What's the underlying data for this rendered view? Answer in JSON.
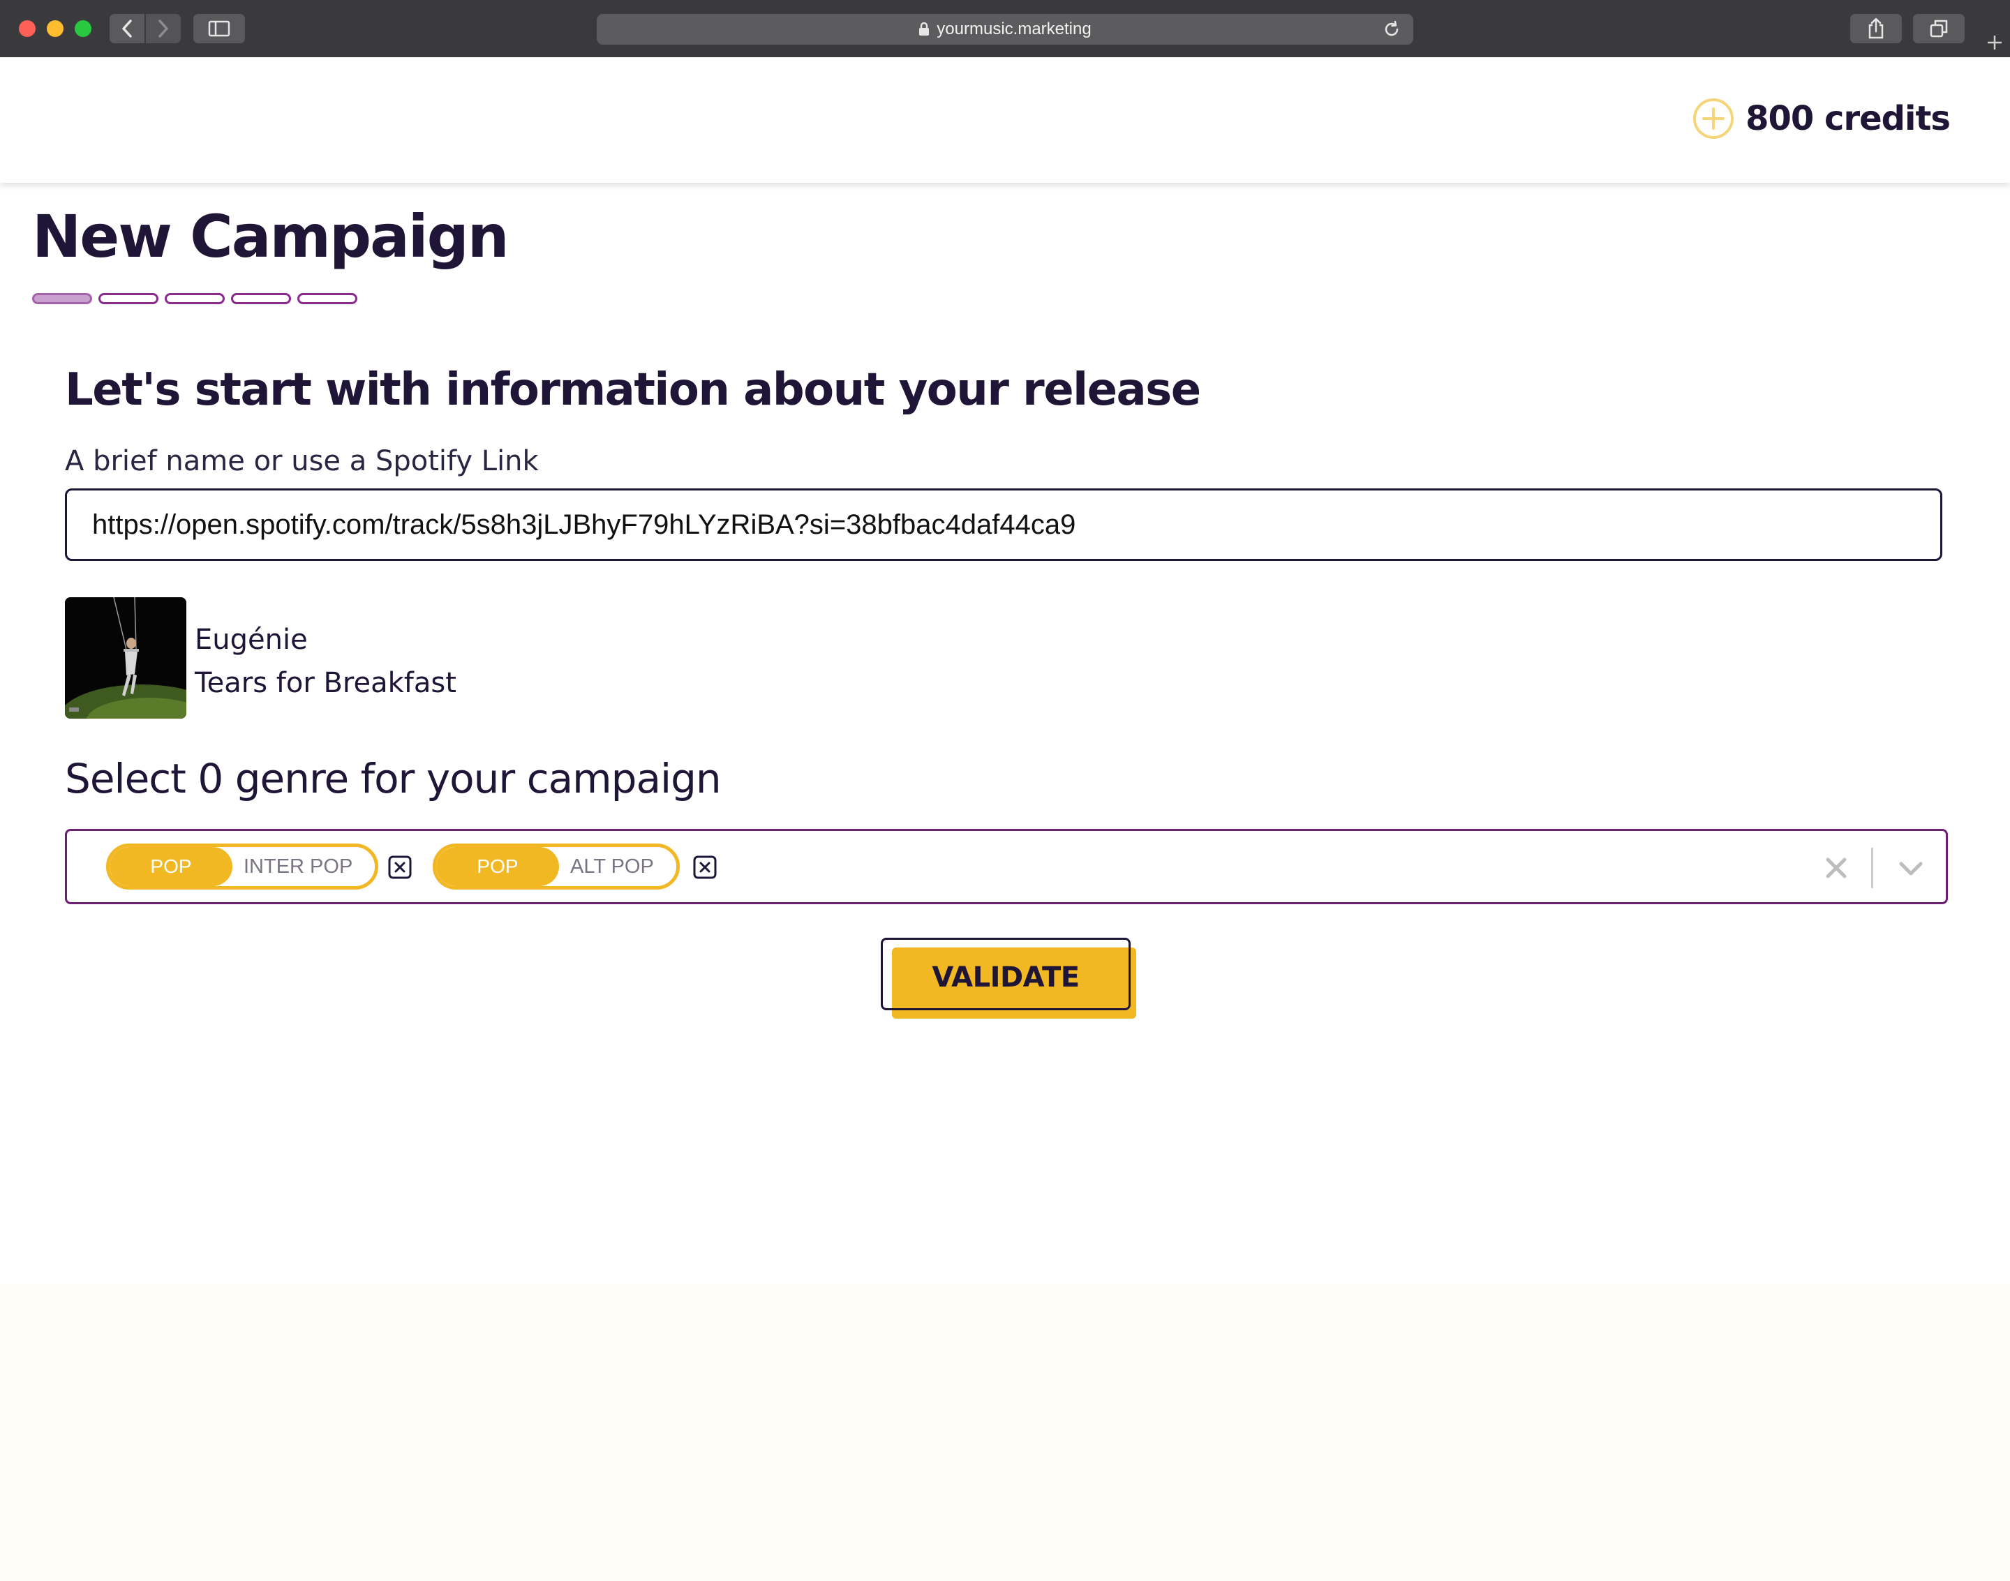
{
  "browser": {
    "url": "yourmusic.marketing"
  },
  "header": {
    "credits": "800 credits"
  },
  "page": {
    "title": "New Campaign",
    "steps_total": 5,
    "current_step": 1
  },
  "release": {
    "heading": "Let's start with information about your release",
    "field_label": "A brief name or use a Spotify Link",
    "field_value": "https://open.spotify.com/track/5s8h3jLJBhyF79hLYzRiBA?si=38bfbac4daf44ca9",
    "track": {
      "artist": "Eugénie",
      "title": "Tears for Breakfast"
    }
  },
  "genres": {
    "label": "Select 0 genre for your campaign",
    "selected": [
      {
        "parent": "POP",
        "sub": "INTER POP"
      },
      {
        "parent": "POP",
        "sub": "ALT POP"
      }
    ]
  },
  "actions": {
    "validate_label": "VALIDATE"
  },
  "colors": {
    "brand_dark": "#1e1537",
    "accent_yellow": "#f2b824",
    "accent_purple": "#6d1f72",
    "step_active": "#c9a1cf"
  }
}
